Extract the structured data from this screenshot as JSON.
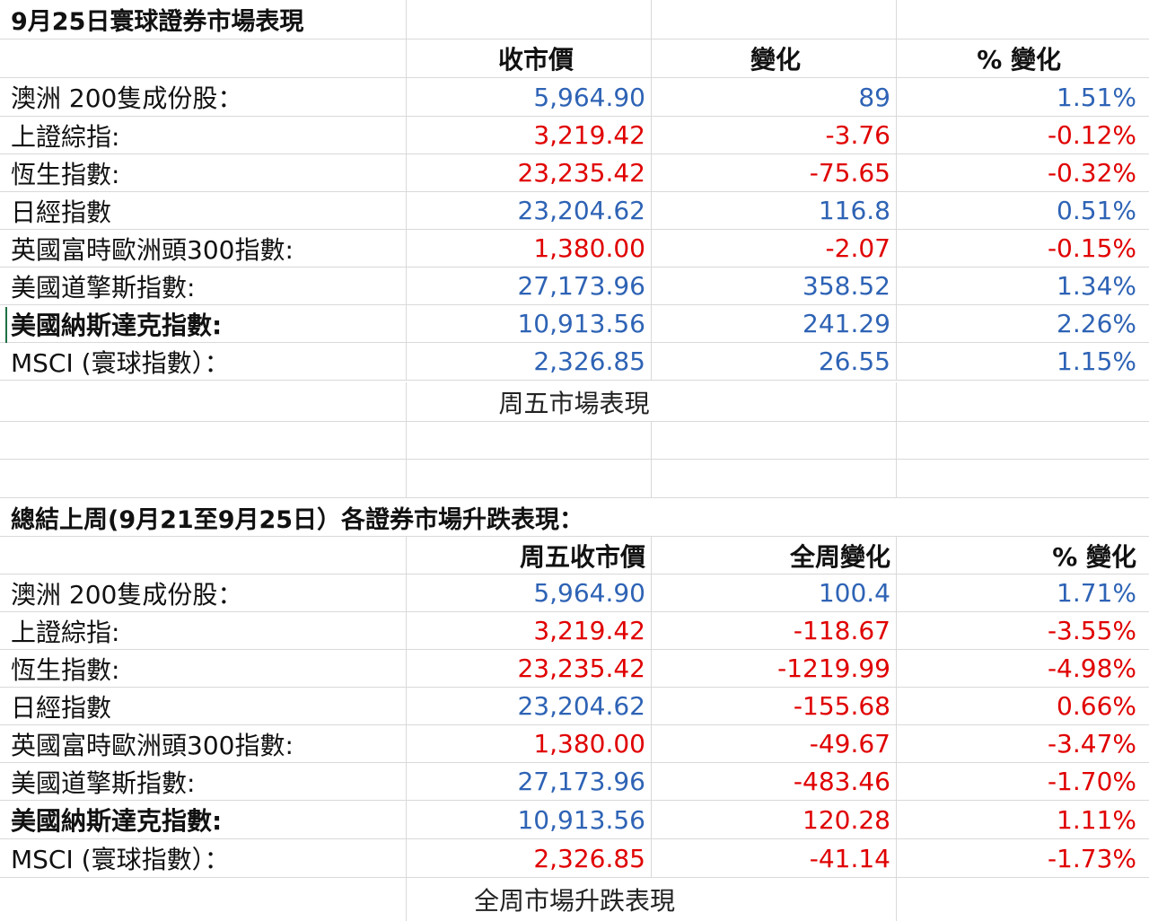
{
  "section1": {
    "title": "9月25日寰球證券市場表現",
    "headers": [
      "收市價",
      "變化",
      "% 變化"
    ],
    "rows": [
      {
        "name": "澳洲 200隻成份股：",
        "close": "5,964.90",
        "change": "89",
        "pct": "1.51%",
        "color": "blue",
        "bold": false
      },
      {
        "name": "上證綜指:",
        "close": "3,219.42",
        "change": "-3.76",
        "pct": "-0.12%",
        "color": "red",
        "bold": false
      },
      {
        "name": "恆生指數:",
        "close": "23,235.42",
        "change": "-75.65",
        "pct": "-0.32%",
        "color": "red",
        "bold": false
      },
      {
        "name": "日經指數",
        "close": "23,204.62",
        "change": "116.8",
        "pct": "0.51%",
        "color": "blue",
        "bold": false
      },
      {
        "name": "英國富時歐洲頭300指數:",
        "close": "1,380.00",
        "change": "-2.07",
        "pct": "-0.15%",
        "color": "red",
        "bold": false
      },
      {
        "name": "美國道擎斯指數:",
        "close": "27,173.96",
        "change": "358.52",
        "pct": "1.34%",
        "color": "blue",
        "bold": false
      },
      {
        "name": "美國納斯達克指數:",
        "close": "10,913.56",
        "change": "241.29",
        "pct": "2.26%",
        "color": "blue",
        "bold": true
      },
      {
        "name": "MSCI (寰球指數）：",
        "close": "2,326.85",
        "change": "26.55",
        "pct": "1.15%",
        "color": "blue",
        "bold": false
      }
    ],
    "caption": "周五市場表現"
  },
  "section2": {
    "title": "總結上周(9月21至9月25日）各證券市場升跌表現：",
    "headers": [
      "周五收市價",
      "全周變化",
      "% 變化"
    ],
    "rows": [
      {
        "name": "澳洲 200隻成份股：",
        "close": "5,964.90",
        "change": "100.4",
        "pct": "1.71%",
        "cc": "blue",
        "chc": "blue",
        "pc": "blue",
        "bold": false
      },
      {
        "name": "上證綜指:",
        "close": "3,219.42",
        "change": "-118.67",
        "pct": "-3.55%",
        "cc": "red",
        "chc": "red",
        "pc": "red",
        "bold": false
      },
      {
        "name": "恆生指數:",
        "close": "23,235.42",
        "change": "-1219.99",
        "pct": "-4.98%",
        "cc": "red",
        "chc": "red",
        "pc": "red",
        "bold": false
      },
      {
        "name": "日經指數",
        "close": "23,204.62",
        "change": "-155.68",
        "pct": "0.66%",
        "cc": "blue",
        "chc": "red",
        "pc": "red",
        "bold": false
      },
      {
        "name": "英國富時歐洲頭300指數:",
        "close": "1,380.00",
        "change": "-49.67",
        "pct": "-3.47%",
        "cc": "red",
        "chc": "red",
        "pc": "red",
        "bold": false
      },
      {
        "name": "美國道擎斯指數:",
        "close": "27,173.96",
        "change": "-483.46",
        "pct": "-1.70%",
        "cc": "blue",
        "chc": "red",
        "pc": "red",
        "bold": false
      },
      {
        "name": "美國納斯達克指數:",
        "close": "10,913.56",
        "change": "120.28",
        "pct": "1.11%",
        "cc": "blue",
        "chc": "red",
        "pc": "red",
        "bold": true
      },
      {
        "name": "MSCI (寰球指數）：",
        "close": "2,326.85",
        "change": "-41.14",
        "pct": "-1.73%",
        "cc": "red",
        "chc": "red",
        "pc": "red",
        "bold": false
      }
    ],
    "caption": "全周市場升跌表現"
  },
  "colors": {
    "blue": "#2e63b5",
    "red": "#e00000",
    "grid": "#d9d9d9"
  }
}
